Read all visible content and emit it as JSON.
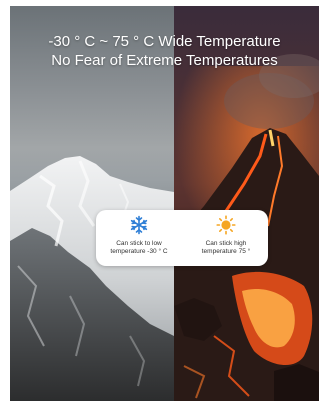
{
  "headline": {
    "line1": "-30 ° C ~ 75 ° C Wide Temperature",
    "line2": "No Fear of Extreme Temperatures"
  },
  "card": {
    "cold": {
      "icon": "snowflake-icon",
      "line1": "Can stick to low",
      "line2": "temperature -30 ° C"
    },
    "hot": {
      "icon": "sun-icon",
      "line1": "Can stick high",
      "line2": "temperature 75 °"
    }
  },
  "colors": {
    "snowflake": "#2f7fd6",
    "sun": "#f5a623",
    "text": "#333333",
    "lava": "#ff5a1a"
  }
}
